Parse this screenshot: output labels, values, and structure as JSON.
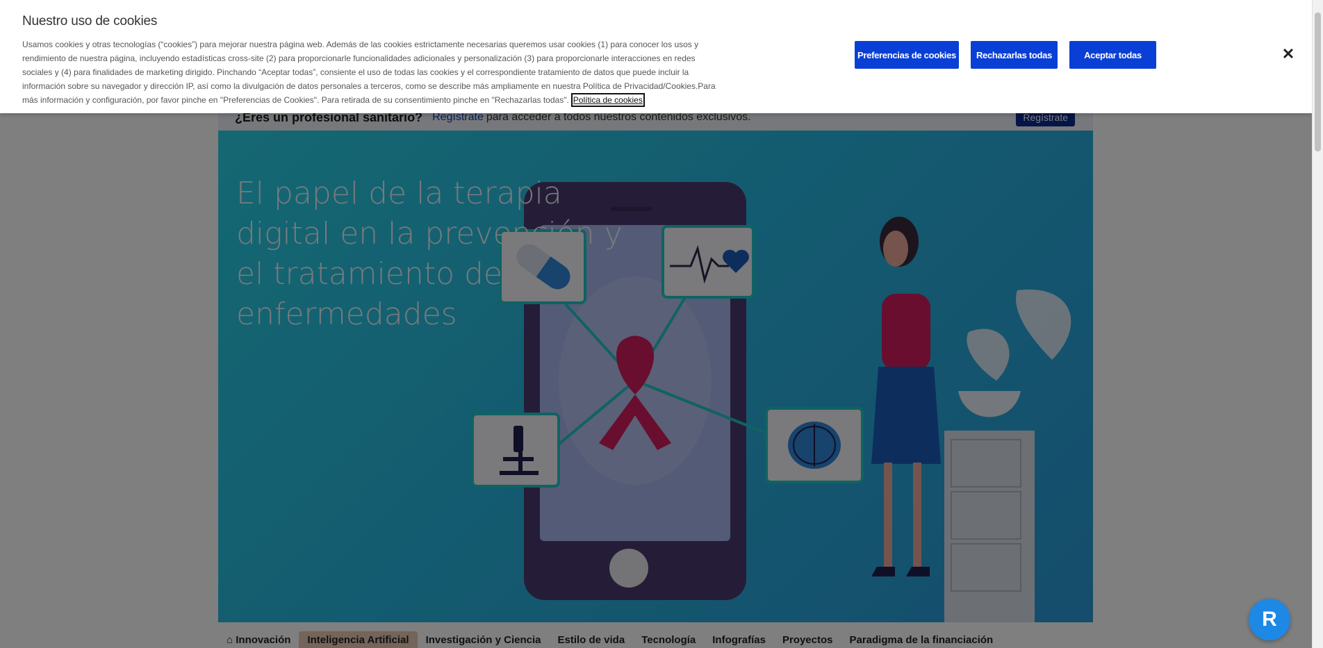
{
  "cookie_banner": {
    "title": "Nuestro uso de cookies",
    "body": "Usamos cookies y otras tecnologías (“cookies”) para mejorar nuestra página web. Además de las cookies estrictamente necesarias queremos usar cookies (1) para conocer los usos y rendimiento de nuestra página, incluyendo estadísticas cross-site (2) para proporcionarle funcionalidades adicionales y personalización (3) para proporcionarle interacciones en redes sociales y (4) para finalidades de marketing dirigido. Pinchando “Aceptar todas”, consiente el uso de todas las cookies y el correspondiente tratamiento de datos que puede incluir la información sobre su navegador y dirección IP, así como la divulgación de datos personales a terceros, como se describe más ampliamente en nuestra Política de Privacidad/Cookies.Para más información y configuración, por favor pinche en \"Preferencias de Cookies\". Para retirada de su consentimiento pinche en \"Rechazarlas todas\".",
    "policy_link": "Política de cookies",
    "btn_preferences": "Preferencias de cookies",
    "btn_reject": "Rechazarlas todas",
    "btn_accept": "Aceptar todas",
    "close_icon": "close-icon"
  },
  "pro_bar": {
    "question": "¿Eres un profesional sanitario?",
    "link": "Regístrate",
    "text": "para acceder a todos nuestros contenidos exclusivos.",
    "button": "Regístrate"
  },
  "hero": {
    "title": "El papel de la terapia digital en la prevención y el tratamiento de enfermedades"
  },
  "tabs": [
    {
      "label": "Innovación",
      "icon": "home-icon"
    },
    {
      "label": "Inteligencia Artificial"
    },
    {
      "label": "Investigación y Ciencia"
    },
    {
      "label": "Estilo de vida"
    },
    {
      "label": "Tecnología"
    },
    {
      "label": "Infografías"
    },
    {
      "label": "Proyectos"
    },
    {
      "label": "Paradigma de la financiación"
    }
  ],
  "fab": {
    "icon": "assistant-icon"
  },
  "colors": {
    "primary_button": "#0a3fd6",
    "hero_bg": "#2ab8e0",
    "active_tab": "#e9c9b3"
  }
}
